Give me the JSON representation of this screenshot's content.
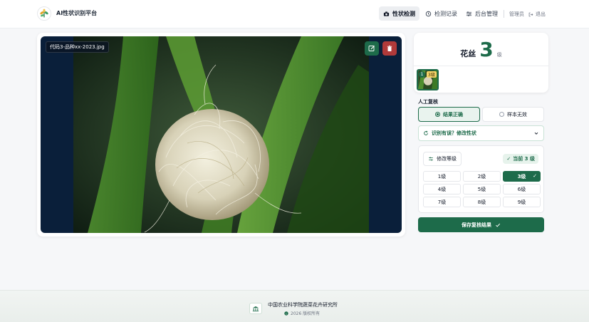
{
  "header": {
    "brand": "AI性状识别平台",
    "nav": [
      {
        "label": "性状检测",
        "icon": "camera-icon",
        "active": true
      },
      {
        "label": "检测记录",
        "icon": "history-icon",
        "active": false
      },
      {
        "label": "后台管理",
        "icon": "sliders-icon",
        "active": false
      }
    ],
    "user": "管理员",
    "logout": "退出"
  },
  "image": {
    "filename": "代码3-品种xx-2023.jpg",
    "edit_icon": "edit-icon",
    "delete_icon": "trash-icon"
  },
  "result": {
    "trait": "花丝",
    "level_number": "3",
    "level_unit": "级",
    "thumbnail": {
      "index": "1",
      "level": "3级"
    }
  },
  "review": {
    "title": "人工复核",
    "option_correct": "结果正确",
    "option_invalid": "样本无效",
    "modify_trait": "识别有误？修改性状",
    "modify_level": "修改等级",
    "current_level": "当前 3 级",
    "grades": [
      "1级",
      "2级",
      "3级",
      "4级",
      "5级",
      "6级",
      "7级",
      "8级",
      "9级"
    ],
    "selected_grade_index": 2,
    "save": "保存复核结果"
  },
  "footer": {
    "org": "中国农业科学院蔬菜花卉研究所",
    "copyright": "2026 版权所有"
  },
  "colors": {
    "accent": "#1d6b4a",
    "danger": "#b03a3a",
    "image_bg": "#0a1f3a"
  }
}
